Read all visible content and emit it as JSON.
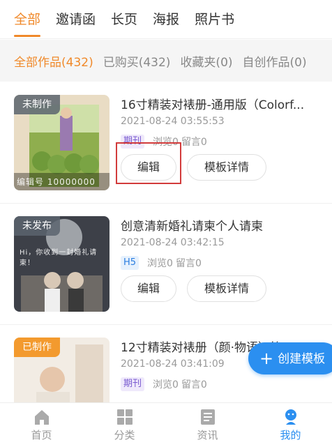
{
  "top_tabs": [
    "全部",
    "邀请函",
    "长页",
    "海报",
    "照片书"
  ],
  "sub_tabs": [
    "全部作品(432)",
    "已购买(432)",
    "收藏夹(0)",
    "自创作品(0)"
  ],
  "cards": [
    {
      "status": "未制作",
      "title": "16寸精装对裱册-通用版（Colorf...",
      "date": "2021-08-24 03:55:53",
      "tag": "期刊",
      "views": "浏览0",
      "comments": "留言0",
      "edit": "编辑",
      "detail": "模板详情",
      "thumb_caption": "编辑号 10000000"
    },
    {
      "status": "未发布",
      "title": "创意清新婚礼请柬个人请柬",
      "date": "2021-08-24 03:42:15",
      "tag": "H5",
      "views": "浏览0",
      "comments": "留言0",
      "edit": "编辑",
      "detail": "模板详情",
      "thumb_caption": "Hi，你收到一封婚礼请柬！"
    },
    {
      "status": "已制作",
      "title": "12寸精装对裱册（颜·物语）简约...",
      "date": "2021-08-24 03:41:09",
      "tag": "期刊",
      "views": "浏览0",
      "comments": "留言0"
    }
  ],
  "fab": "创建模板",
  "bottom_nav": [
    "首页",
    "分类",
    "资讯",
    "我的"
  ],
  "colors": {
    "accent": "#f0892a",
    "blue": "#2b8ff0",
    "highlight": "#d23b3b"
  }
}
